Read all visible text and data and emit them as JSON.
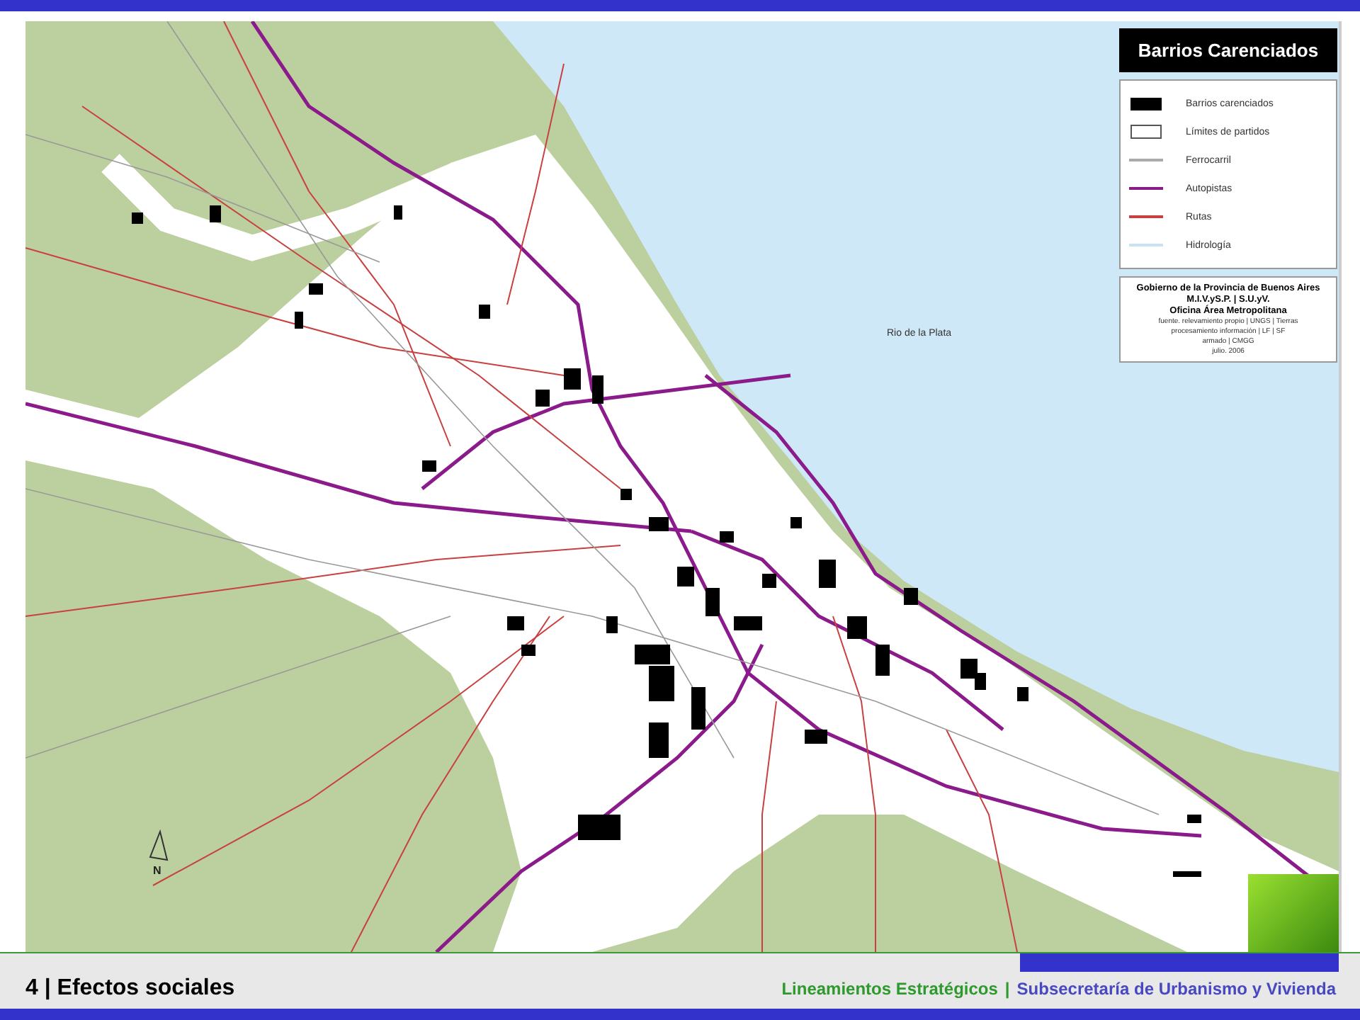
{
  "map": {
    "water_label": "Rio de la Plata",
    "north_label": "N"
  },
  "legend": {
    "title": "Barrios Carenciados",
    "items": [
      {
        "label": "Barrios carenciados",
        "kind": "fill",
        "color": "#000000"
      },
      {
        "label": "Límites de partidos",
        "kind": "outline",
        "color": "#555555"
      },
      {
        "label": "Ferrocarril",
        "kind": "line",
        "color": "#aaaaaa"
      },
      {
        "label": "Autopistas",
        "kind": "line",
        "color": "#8b1a8b"
      },
      {
        "label": "Rutas",
        "kind": "line",
        "color": "#c84040"
      },
      {
        "label": "Hidrología",
        "kind": "line",
        "color": "#c8e4f0"
      }
    ],
    "credits": {
      "heading_lines": [
        "Gobierno de la Provincia de Buenos Aires",
        "M.I.V.yS.P. | S.U.yV.",
        "Oficina Área Metropolitana"
      ],
      "detail_lines": [
        "fuente. relevamiento propio | UNGS | Tierras",
        "procesamiento información | LF | SF",
        "armado | CMGG",
        "julio. 2006"
      ]
    }
  },
  "footer": {
    "slide_title": "4 | Efectos sociales",
    "left_credit": "Lineamientos Estratégicos",
    "separator": "|",
    "right_credit": "Subsecretaría de Urbanismo y Vivienda"
  }
}
